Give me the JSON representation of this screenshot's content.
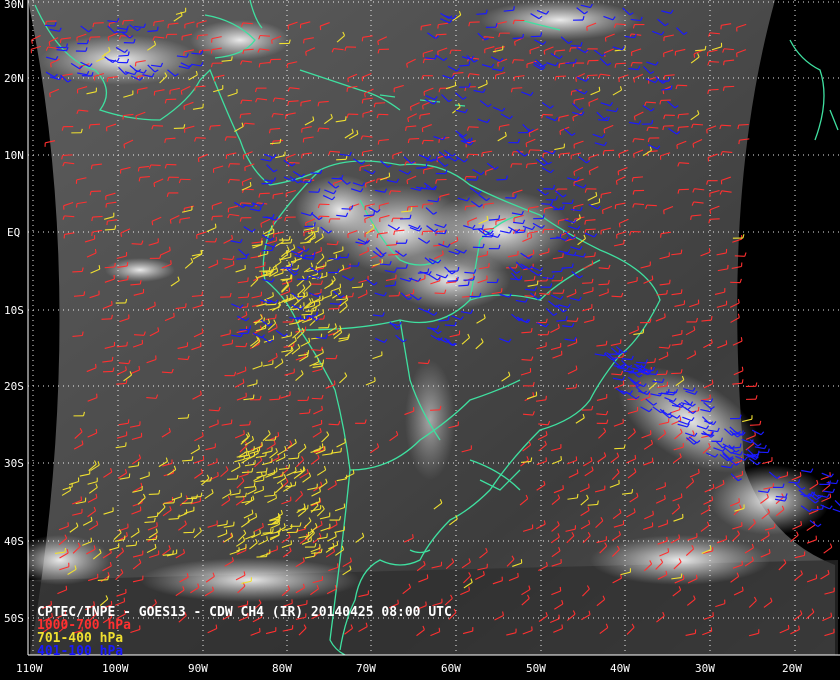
{
  "map": {
    "title": "CPTEC/INPE - GOES13 - CDW CH4 (IR) 20140425 08:00 UTC",
    "legend": [
      {
        "label": "1000-700 hPa",
        "color": "#ff3030"
      },
      {
        "label": "701-400 hPa",
        "color": "#f0e030"
      },
      {
        "label": "401-100 hPa",
        "color": "#1a1aff"
      }
    ],
    "lat_labels": [
      "30N",
      "20N",
      "10N",
      "EQ",
      "10S",
      "20S",
      "30S",
      "40S",
      "50S"
    ],
    "lon_labels": [
      "110W",
      "100W",
      "90W",
      "80W",
      "70W",
      "60W",
      "50W",
      "40W",
      "30W",
      "20W"
    ],
    "colors": {
      "coastline": "#3fe0a0",
      "grid": "#ffffff",
      "background": "#000000",
      "frame": "#ffffff"
    }
  }
}
